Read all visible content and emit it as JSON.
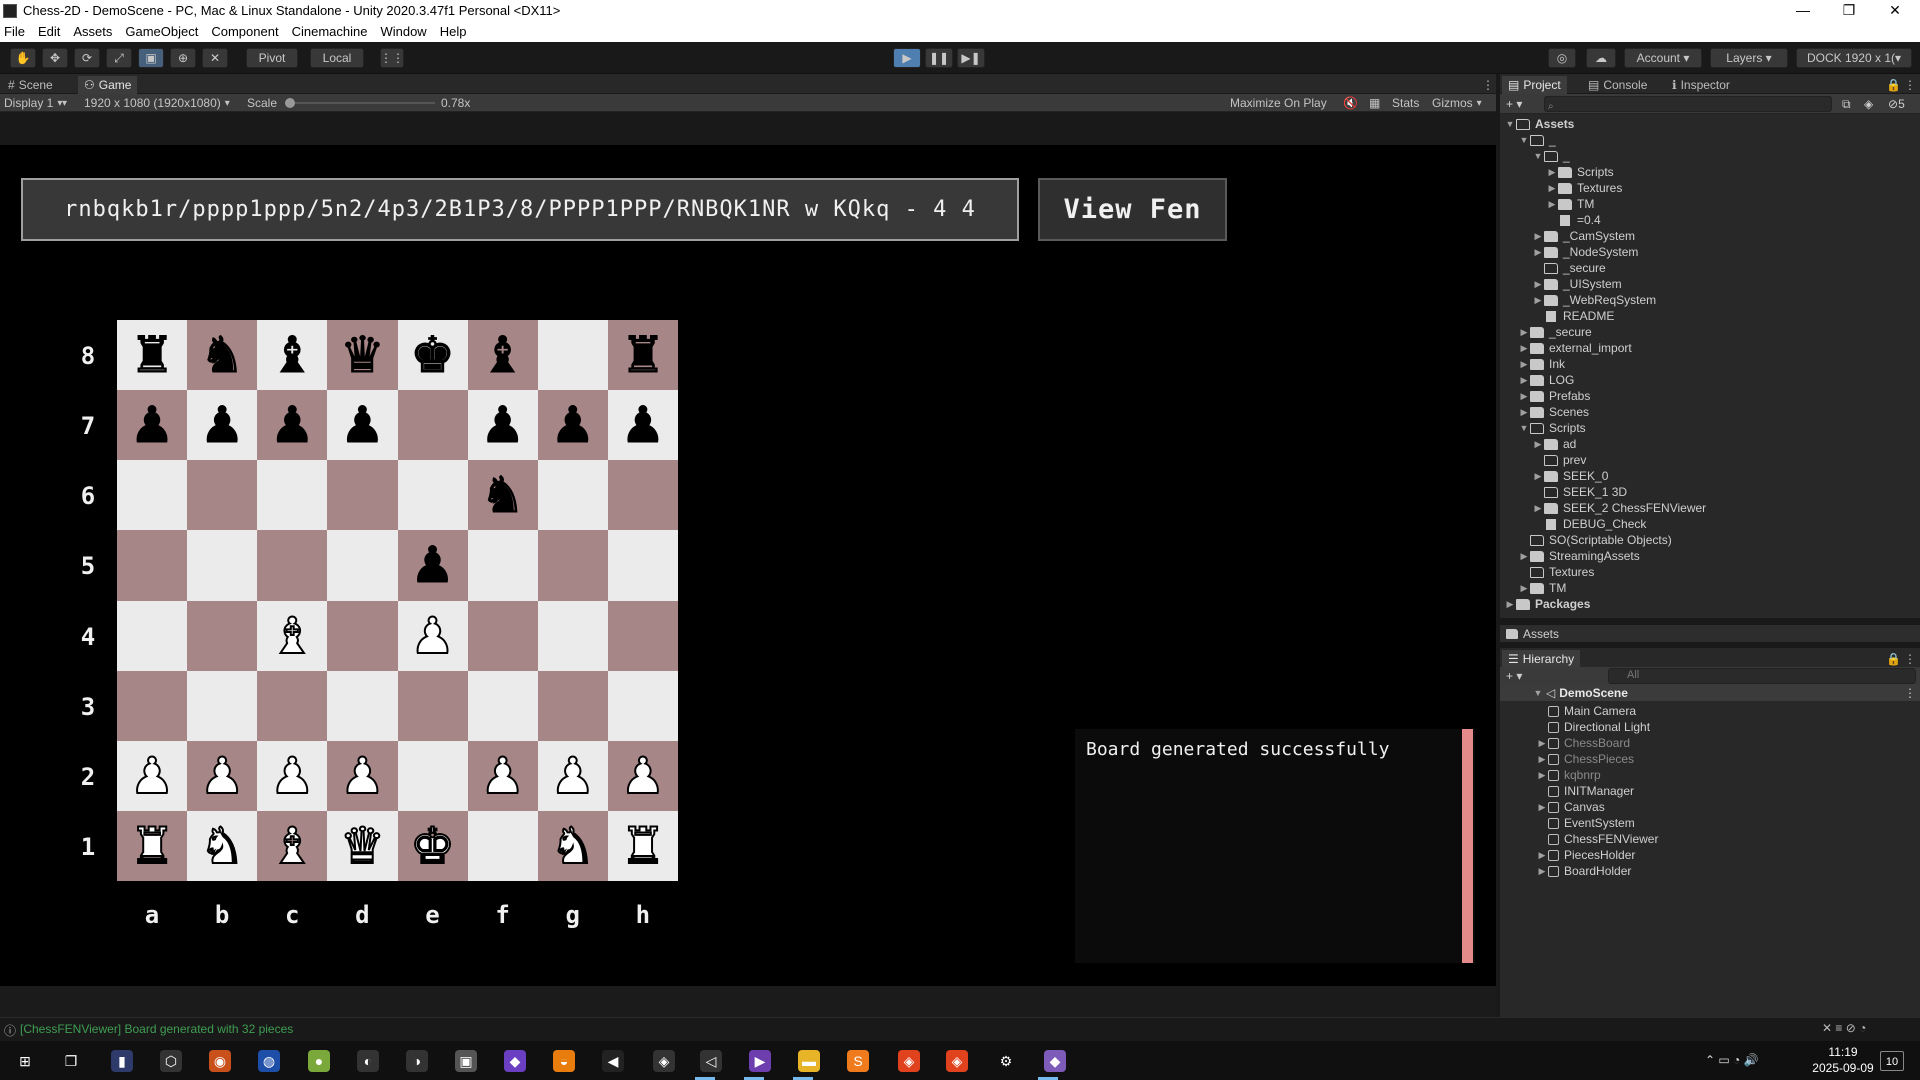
{
  "window": {
    "title": "Chess-2D - DemoScene - PC, Mac & Linux Standalone - Unity 2020.3.47f1 Personal <DX11>",
    "minimize": "—",
    "maximize": "❐",
    "close": "✕"
  },
  "menu": [
    "File",
    "Edit",
    "Assets",
    "GameObject",
    "Component",
    "Cinemachine",
    "Window",
    "Help"
  ],
  "toolbar": {
    "pivot": "Pivot",
    "local": "Local",
    "account": "Account",
    "layers": "Layers",
    "layout": "DOCK 1920 x 1("
  },
  "scene_tabs": {
    "scene": "Scene",
    "game": "Game"
  },
  "game_bar": {
    "display": "Display 1",
    "resolution": "1920 x 1080 (1920x1080)",
    "scale_label": "Scale",
    "scale_value": "0.78x",
    "maximize": "Maximize On Play",
    "stats": "Stats",
    "gizmos": "Gizmos"
  },
  "game": {
    "fen": "rnbqkb1r/pppp1ppp/5n2/4p3/2B1P3/8/PPPP1PPP/RNBQK1NR w KQkq - 4 4",
    "view_fen_button": "View Fen",
    "log_message": "Board generated successfully",
    "ranks": [
      "8",
      "7",
      "6",
      "5",
      "4",
      "3",
      "2",
      "1"
    ],
    "files": [
      "a",
      "b",
      "c",
      "d",
      "e",
      "f",
      "g",
      "h"
    ],
    "board": [
      [
        "r",
        "n",
        "b",
        "q",
        "k",
        "b",
        "",
        "r"
      ],
      [
        "p",
        "p",
        "p",
        "p",
        "",
        "p",
        "p",
        "p"
      ],
      [
        "",
        "",
        "",
        "",
        "",
        "n",
        "",
        ""
      ],
      [
        "",
        "",
        "",
        "",
        "p",
        "",
        "",
        ""
      ],
      [
        "",
        "",
        "B",
        "",
        "P",
        "",
        "",
        ""
      ],
      [
        "",
        "",
        "",
        "",
        "",
        "",
        "",
        ""
      ],
      [
        "P",
        "P",
        "P",
        "P",
        "",
        "P",
        "P",
        "P"
      ],
      [
        "R",
        "N",
        "B",
        "Q",
        "K",
        "",
        "N",
        "R"
      ]
    ],
    "colors": {
      "light": "#ebebeb",
      "dark": "#a78687",
      "log_scroll": "#e48a8a"
    }
  },
  "project_panel": {
    "tabs": {
      "project": "Project",
      "console": "Console",
      "inspector": "Inspector"
    },
    "footer": "Assets",
    "badge": "5",
    "tree": [
      {
        "label": "Assets",
        "depth": 0,
        "arrow": "open",
        "icon": "folder-open",
        "bold": true
      },
      {
        "label": "_",
        "depth": 1,
        "arrow": "open",
        "icon": "folder-open"
      },
      {
        "label": "_",
        "depth": 2,
        "arrow": "open",
        "icon": "folder-open"
      },
      {
        "label": "Scripts",
        "depth": 3,
        "arrow": "closed",
        "icon": "folder"
      },
      {
        "label": "Textures",
        "depth": 3,
        "arrow": "closed",
        "icon": "folder"
      },
      {
        "label": "TM",
        "depth": 3,
        "arrow": "closed",
        "icon": "folder"
      },
      {
        "label": "=0.4",
        "depth": 3,
        "arrow": "none",
        "icon": "file"
      },
      {
        "label": "_CamSystem",
        "depth": 2,
        "arrow": "closed",
        "icon": "folder"
      },
      {
        "label": "_NodeSystem",
        "depth": 2,
        "arrow": "closed",
        "icon": "folder"
      },
      {
        "label": "_secure",
        "depth": 2,
        "arrow": "none",
        "icon": "folder-open"
      },
      {
        "label": "_UISystem",
        "depth": 2,
        "arrow": "closed",
        "icon": "folder"
      },
      {
        "label": "_WebReqSystem",
        "depth": 2,
        "arrow": "closed",
        "icon": "folder"
      },
      {
        "label": "README",
        "depth": 2,
        "arrow": "none",
        "icon": "file"
      },
      {
        "label": "_secure",
        "depth": 1,
        "arrow": "closed",
        "icon": "folder"
      },
      {
        "label": "external_import",
        "depth": 1,
        "arrow": "closed",
        "icon": "folder"
      },
      {
        "label": "Ink",
        "depth": 1,
        "arrow": "closed",
        "icon": "folder"
      },
      {
        "label": "LOG",
        "depth": 1,
        "arrow": "closed",
        "icon": "folder"
      },
      {
        "label": "Prefabs",
        "depth": 1,
        "arrow": "closed",
        "icon": "folder"
      },
      {
        "label": "Scenes",
        "depth": 1,
        "arrow": "closed",
        "icon": "folder"
      },
      {
        "label": "Scripts",
        "depth": 1,
        "arrow": "open",
        "icon": "folder-open"
      },
      {
        "label": "ad",
        "depth": 2,
        "arrow": "closed",
        "icon": "folder"
      },
      {
        "label": "prev",
        "depth": 2,
        "arrow": "none",
        "icon": "folder-open"
      },
      {
        "label": "SEEK_0",
        "depth": 2,
        "arrow": "closed",
        "icon": "folder"
      },
      {
        "label": "SEEK_1 3D",
        "depth": 2,
        "arrow": "none",
        "icon": "folder-open"
      },
      {
        "label": "SEEK_2 ChessFENViewer",
        "depth": 2,
        "arrow": "closed",
        "icon": "folder"
      },
      {
        "label": "DEBUG_Check",
        "depth": 2,
        "arrow": "none",
        "icon": "file"
      },
      {
        "label": "SO(Scriptable Objects)",
        "depth": 1,
        "arrow": "none",
        "icon": "folder-open"
      },
      {
        "label": "StreamingAssets",
        "depth": 1,
        "arrow": "closed",
        "icon": "folder"
      },
      {
        "label": "Textures",
        "depth": 1,
        "arrow": "none",
        "icon": "folder-open"
      },
      {
        "label": "TM",
        "depth": 1,
        "arrow": "closed",
        "icon": "folder"
      },
      {
        "label": "Packages",
        "depth": 0,
        "arrow": "closed",
        "icon": "folder",
        "bold": true
      }
    ]
  },
  "hierarchy": {
    "title": "Hierarchy",
    "search_placeholder": "All",
    "scene": "DemoScene",
    "items": [
      {
        "label": "Main Camera",
        "arrow": false,
        "dim": false
      },
      {
        "label": "Directional Light",
        "arrow": false,
        "dim": false
      },
      {
        "label": "ChessBoard",
        "arrow": true,
        "dim": true
      },
      {
        "label": "ChessPieces",
        "arrow": true,
        "dim": true
      },
      {
        "label": "kqbnrp",
        "arrow": true,
        "dim": true
      },
      {
        "label": "INITManager",
        "arrow": false,
        "dim": false
      },
      {
        "label": "Canvas",
        "arrow": true,
        "dim": false
      },
      {
        "label": "EventSystem",
        "arrow": false,
        "dim": false
      },
      {
        "label": "ChessFENViewer",
        "arrow": false,
        "dim": false
      },
      {
        "label": "PiecesHolder",
        "arrow": true,
        "dim": false
      },
      {
        "label": "BoardHolder",
        "arrow": true,
        "dim": false
      }
    ]
  },
  "status": {
    "message": "[ChessFENViewer] Board generated with 32 pieces"
  },
  "taskbar": {
    "time": "11:19",
    "date": "2025-09-09",
    "notif": "10"
  }
}
